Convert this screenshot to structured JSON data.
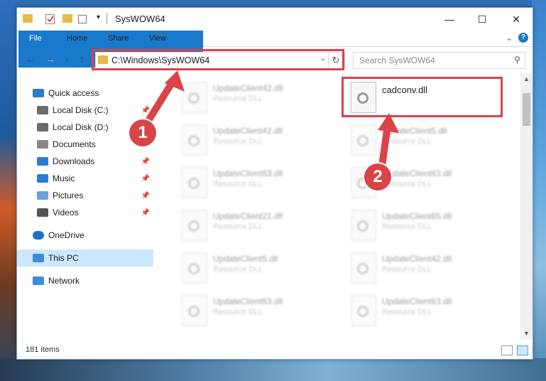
{
  "window": {
    "title": "SysWOW64",
    "controls": {
      "minimize": "—",
      "maximize": "☐",
      "close": "✕"
    }
  },
  "ribbon": {
    "tabs": [
      "File",
      "Home",
      "Share",
      "View"
    ],
    "expand": "⌄",
    "help": "?"
  },
  "nav": {
    "back": "←",
    "forward": "→",
    "recent": "⌄",
    "up": "↑",
    "address": "C:\\Windows\\SysWOW64",
    "search_placeholder": "Search SysWOW64"
  },
  "sidebar": {
    "items": [
      {
        "label": "Quick access",
        "icon": "star-icon",
        "pinned": false
      },
      {
        "label": "Local Disk (C:)",
        "icon": "drive-icon",
        "pinned": true
      },
      {
        "label": "Local Disk (D:)",
        "icon": "drive-icon",
        "pinned": false
      },
      {
        "label": "Documents",
        "icon": "documents-icon",
        "pinned": true
      },
      {
        "label": "Downloads",
        "icon": "downloads-icon",
        "pinned": true
      },
      {
        "label": "Music",
        "icon": "music-icon",
        "pinned": true
      },
      {
        "label": "Pictures",
        "icon": "pictures-icon",
        "pinned": true
      },
      {
        "label": "Videos",
        "icon": "videos-icon",
        "pinned": true
      },
      {
        "label": "OneDrive",
        "icon": "cloud-icon",
        "pinned": false
      },
      {
        "label": "This PC",
        "icon": "computer-icon",
        "pinned": false,
        "selected": true
      },
      {
        "label": "Network",
        "icon": "network-icon",
        "pinned": false
      }
    ]
  },
  "files": [
    {
      "name": "UpdateClient42.dll",
      "type": "Resource DLL",
      "blurred": true
    },
    {
      "name": "cadconv.dll",
      "type": "",
      "blurred": false
    },
    {
      "name": "UpdateClient42.dll",
      "type": "Resource DLL",
      "blurred": true
    },
    {
      "name": "UpdateClient5.dll",
      "type": "Resource DLL",
      "blurred": true
    },
    {
      "name": "UpdateClient63.dll",
      "type": "Resource DLL",
      "blurred": true
    },
    {
      "name": "UpdateClient63.dll",
      "type": "Resource DLL",
      "blurred": true
    },
    {
      "name": "UpdateClient21.dll",
      "type": "Resource DLL",
      "blurred": true
    },
    {
      "name": "UpdateClient65.dll",
      "type": "Resource DLL",
      "blurred": true
    },
    {
      "name": "UpdateClient5.dll",
      "type": "Resource DLL",
      "blurred": true
    },
    {
      "name": "UpdateClient42.dll",
      "type": "Resource DLL",
      "blurred": true
    },
    {
      "name": "UpdateClient63.dll",
      "type": "Resource DLL",
      "blurred": true
    },
    {
      "name": "UpdateClient63.dll",
      "type": "Resource DLL",
      "blurred": true
    }
  ],
  "status": {
    "count": "181 items"
  },
  "annotations": {
    "badge1": "1",
    "badge2": "2",
    "color": "#d94448"
  }
}
